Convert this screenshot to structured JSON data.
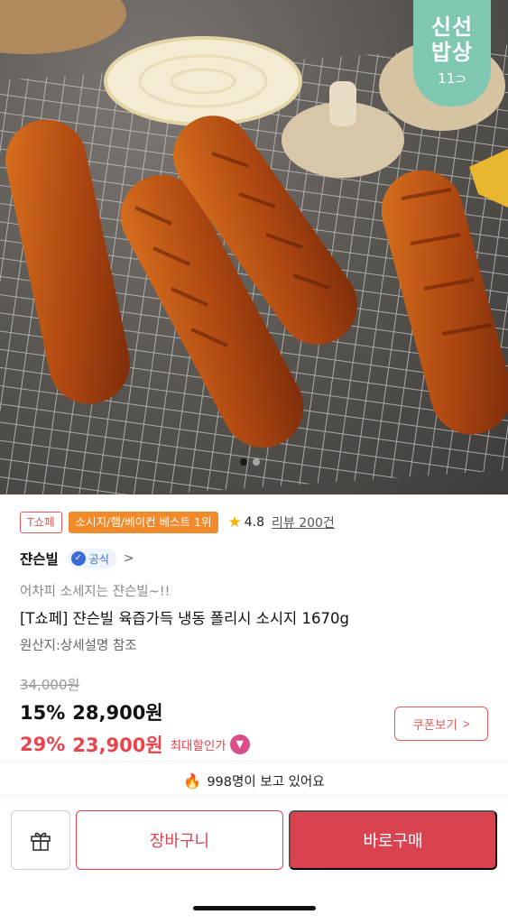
{
  "hero": {
    "badge_line1": "신선",
    "badge_line2": "밥상",
    "badge_mark": "11⊃",
    "page_dots": 2
  },
  "tags": {
    "tshop": "T쇼페",
    "best": "소시지/햄/베이컨 베스트 1위"
  },
  "rating": {
    "value": "4.8",
    "review_link": "리뷰 200건"
  },
  "seller": {
    "name": "쟌슨빌",
    "official_label": "공식"
  },
  "product": {
    "promo_text": "어차피 소세지는 쟌슨빌~!!",
    "title": "[T쇼페] 쟌슨빌 육즙가득 냉동 폴리시 소시지 1670g",
    "origin": "원산지:상세설명 참조"
  },
  "price": {
    "original": "34,000원",
    "discount_pct": "15%",
    "discount_price": "28,900원",
    "max_pct": "29%",
    "max_price": "23,900원",
    "max_label": "최대할인가",
    "coupon_button": "쿠폰보기"
  },
  "viewers": {
    "text": "998명이 보고 있어요"
  },
  "bottom_bar": {
    "cart_button": "장바구니",
    "buy_button": "바로구매"
  },
  "colors": {
    "accent_red": "#d9434f",
    "best_orange": "#f08a2a",
    "badge_mint": "#7fc7b1",
    "official_blue": "#3b6bd9"
  }
}
